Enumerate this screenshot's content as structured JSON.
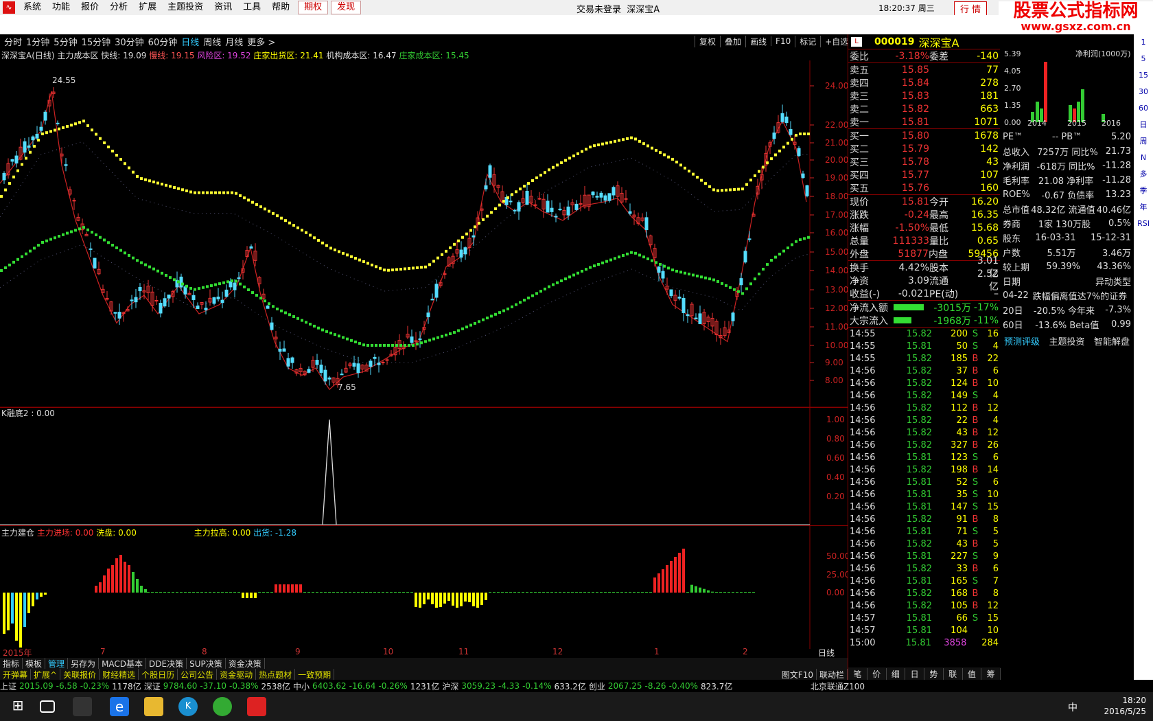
{
  "menubar": {
    "items": [
      "系统",
      "功能",
      "报价",
      "分析",
      "扩展",
      "主题投资",
      "资讯",
      "工具",
      "帮助"
    ],
    "qiquan": "期权",
    "faxian": "发现",
    "login": "交易未登录",
    "stock": "深深宝A",
    "clock": "18:20:37 周三",
    "trade": "行 情"
  },
  "brand": {
    "title": "股票公式指标网",
    "url": "www.gsxz.com.cn"
  },
  "periods": [
    "分时",
    "1分钟",
    "5分钟",
    "15分钟",
    "30分钟",
    "60分钟",
    "日线",
    "周线",
    "月线",
    "更多 >"
  ],
  "period_active": "日线",
  "rightbtns": [
    "复权",
    "叠加",
    "画线",
    "F10",
    "标记",
    "+自选"
  ],
  "legend": {
    "name": "深深宝A(日线) 主力成本区",
    "kuai": "快线: 19.09",
    "man": "慢线: 19.15",
    "feng": "风险区: 19.52",
    "zhuang": "庄家出货区: 21.41",
    "jigou": "机构成本区: 16.47",
    "zcb": "庄家成本区: 15.45"
  },
  "yaxis": [
    "24.00",
    "22.00",
    "21.00",
    "20.00",
    "19.00",
    "18.00",
    "17.00",
    "16.00",
    "15.00",
    "14.00",
    "13.00",
    "12.00",
    "11.00",
    "10.00",
    "9.00",
    "8.00"
  ],
  "hi_label": "24.55",
  "lo_label": "7.65",
  "sub1": {
    "label": "K融底2 : 0.00",
    "yaxis": [
      "1.00",
      "0.80",
      "0.60",
      "0.40",
      "0.20"
    ]
  },
  "sub2": {
    "l1": "主力建仓",
    "l2": "主力进场: 0.00",
    "l3": "洗盘: 0.00",
    "l4": "主力拉高: 0.00",
    "l5": "出货: -1.28",
    "yaxis": [
      "50.00",
      "25.00",
      "0.00"
    ]
  },
  "xaxis": [
    "2015年",
    "7",
    "8",
    "9",
    "10",
    "11",
    "12",
    "1",
    "2",
    "日线"
  ],
  "tabs1": [
    "指标",
    "模板",
    "管理",
    "另存为",
    "MACD基本",
    "DDE决策",
    "SUP决策",
    "资金决策"
  ],
  "tabs2": [
    "开弹幕",
    "扩展^",
    "关联报价",
    "财经精选",
    "个股日历",
    "公司公告",
    "资金驱动",
    "热点题材",
    "一致预期"
  ],
  "tabs2_right": [
    "图文F10",
    "联动栏"
  ],
  "quote": {
    "code": "000019",
    "name": "深深宝A",
    "weibi": [
      "委比",
      "-3.18%",
      "委差",
      "-140"
    ],
    "sell": [
      [
        "卖五",
        "15.85",
        "77"
      ],
      [
        "卖四",
        "15.84",
        "278"
      ],
      [
        "卖三",
        "15.83",
        "181"
      ],
      [
        "卖二",
        "15.82",
        "663"
      ],
      [
        "卖一",
        "15.81",
        "1071"
      ]
    ],
    "buy": [
      [
        "买一",
        "15.80",
        "1678"
      ],
      [
        "买二",
        "15.79",
        "142"
      ],
      [
        "买三",
        "15.78",
        "43"
      ],
      [
        "买四",
        "15.77",
        "107"
      ],
      [
        "买五",
        "15.76",
        "160"
      ]
    ],
    "info": [
      [
        "现价",
        "15.81",
        "今开",
        "16.20"
      ],
      [
        "涨跌",
        "-0.24",
        "最高",
        "16.35"
      ],
      [
        "涨幅",
        "-1.50%",
        "最低",
        "15.68"
      ],
      [
        "总量",
        "111333",
        "量比",
        "0.65"
      ],
      [
        "外盘",
        "51877",
        "内盘",
        "59456"
      ]
    ],
    "info2": [
      [
        "换手",
        "4.42%",
        "股本",
        "3.01亿"
      ],
      [
        "净资",
        "3.09",
        "流通",
        "2.52亿"
      ],
      [
        "收益(-)",
        "-0.021",
        "PE(动)",
        "–"
      ]
    ],
    "flow": [
      [
        "净流入额",
        "-3015万",
        "-17%"
      ],
      [
        "大宗流入",
        "-1968万",
        "-11%"
      ]
    ],
    "ticks": [
      [
        "14:55",
        "15.82",
        "200",
        "S",
        "16"
      ],
      [
        "14:55",
        "15.81",
        "50",
        "S",
        "4"
      ],
      [
        "14:55",
        "15.82",
        "185",
        "B",
        "22"
      ],
      [
        "14:56",
        "15.82",
        "37",
        "B",
        "6"
      ],
      [
        "14:56",
        "15.82",
        "124",
        "B",
        "10"
      ],
      [
        "14:56",
        "15.82",
        "149",
        "S",
        "4"
      ],
      [
        "14:56",
        "15.82",
        "112",
        "B",
        "12"
      ],
      [
        "14:56",
        "15.82",
        "22",
        "B",
        "4"
      ],
      [
        "14:56",
        "15.82",
        "43",
        "B",
        "12"
      ],
      [
        "14:56",
        "15.82",
        "327",
        "B",
        "26"
      ],
      [
        "14:56",
        "15.81",
        "123",
        "S",
        "6"
      ],
      [
        "14:56",
        "15.82",
        "198",
        "B",
        "14"
      ],
      [
        "14:56",
        "15.81",
        "52",
        "S",
        "6"
      ],
      [
        "14:56",
        "15.81",
        "35",
        "S",
        "10"
      ],
      [
        "14:56",
        "15.81",
        "147",
        "S",
        "15"
      ],
      [
        "14:56",
        "15.82",
        "91",
        "B",
        "8"
      ],
      [
        "14:56",
        "15.81",
        "71",
        "S",
        "5"
      ],
      [
        "14:56",
        "15.82",
        "43",
        "B",
        "5"
      ],
      [
        "14:56",
        "15.81",
        "227",
        "S",
        "9"
      ],
      [
        "14:56",
        "15.82",
        "33",
        "B",
        "6"
      ],
      [
        "14:56",
        "15.81",
        "165",
        "S",
        "7"
      ],
      [
        "14:56",
        "15.82",
        "168",
        "B",
        "8"
      ],
      [
        "14:56",
        "15.82",
        "105",
        "B",
        "12"
      ],
      [
        "14:57",
        "15.81",
        "66",
        "S",
        "15"
      ],
      [
        "14:57",
        "15.81",
        "104",
        "",
        "10"
      ],
      [
        "15:00",
        "15.81",
        "3858",
        "",
        "284"
      ]
    ],
    "bottomtabs": [
      "笔",
      "价",
      "细",
      "日",
      "势",
      "联",
      "值",
      "筹"
    ]
  },
  "finance": {
    "chart_title": "净利润(1000万)",
    "chart_y": [
      "5.39",
      "4.05",
      "2.70",
      "1.35",
      "0.00"
    ],
    "chart_x": [
      "2014",
      "2015",
      "2016"
    ],
    "rows": [
      [
        "PE™",
        "-- PB™",
        "5.20"
      ],
      [
        "总收入",
        "7257万 同比%",
        "21.73"
      ],
      [
        "净利润",
        "-618万 同比%",
        "-11.28"
      ],
      [
        "毛利率",
        "21.08 净利率",
        "-11.28"
      ],
      [
        "ROE%",
        "-0.67 负债率",
        "13.23"
      ],
      [
        "总市值",
        "48.32亿 流通值",
        "40.46亿"
      ],
      [
        "券商",
        "1家 130万股",
        "0.5%"
      ],
      [
        "股东",
        "16-03-31",
        "15-12-31"
      ],
      [
        "户数",
        "5.51万",
        "3.46万"
      ],
      [
        "较上期",
        "59.39%",
        "43.36%"
      ],
      [
        "日期",
        "",
        "异动类型"
      ],
      [
        "04-22",
        "跌幅偏离值达7%的证券",
        ""
      ],
      [
        "20日",
        "-20.5% 今年来",
        "-7.3%"
      ],
      [
        "60日",
        "-13.6% Beta值",
        "0.99"
      ]
    ],
    "links": [
      "预测评级",
      "主题投资",
      "智能解盘"
    ]
  },
  "sidebar": [
    "1",
    "5",
    "15",
    "30",
    "60",
    "日",
    "周",
    "N",
    "多",
    "季",
    "年",
    "RSI"
  ],
  "status": [
    [
      "上证",
      "2015.09",
      "-6.58",
      "-0.23%",
      "1178亿"
    ],
    [
      "深证",
      "9784.60",
      "-37.10",
      "-0.38%",
      "2538亿"
    ],
    [
      "中小",
      "6403.62",
      "-16.64",
      "-0.26%",
      "1231亿"
    ],
    [
      "沪深",
      "3059.23",
      "-4.33",
      "-0.14%",
      "633.2亿"
    ],
    [
      "创业",
      "2067.25",
      "-8.26",
      "-0.40%",
      "823.7亿"
    ]
  ],
  "status_right": "北京联通Z100",
  "taskbar": {
    "time": "18:20",
    "date": "2016/5/25",
    "ime": "中"
  }
}
